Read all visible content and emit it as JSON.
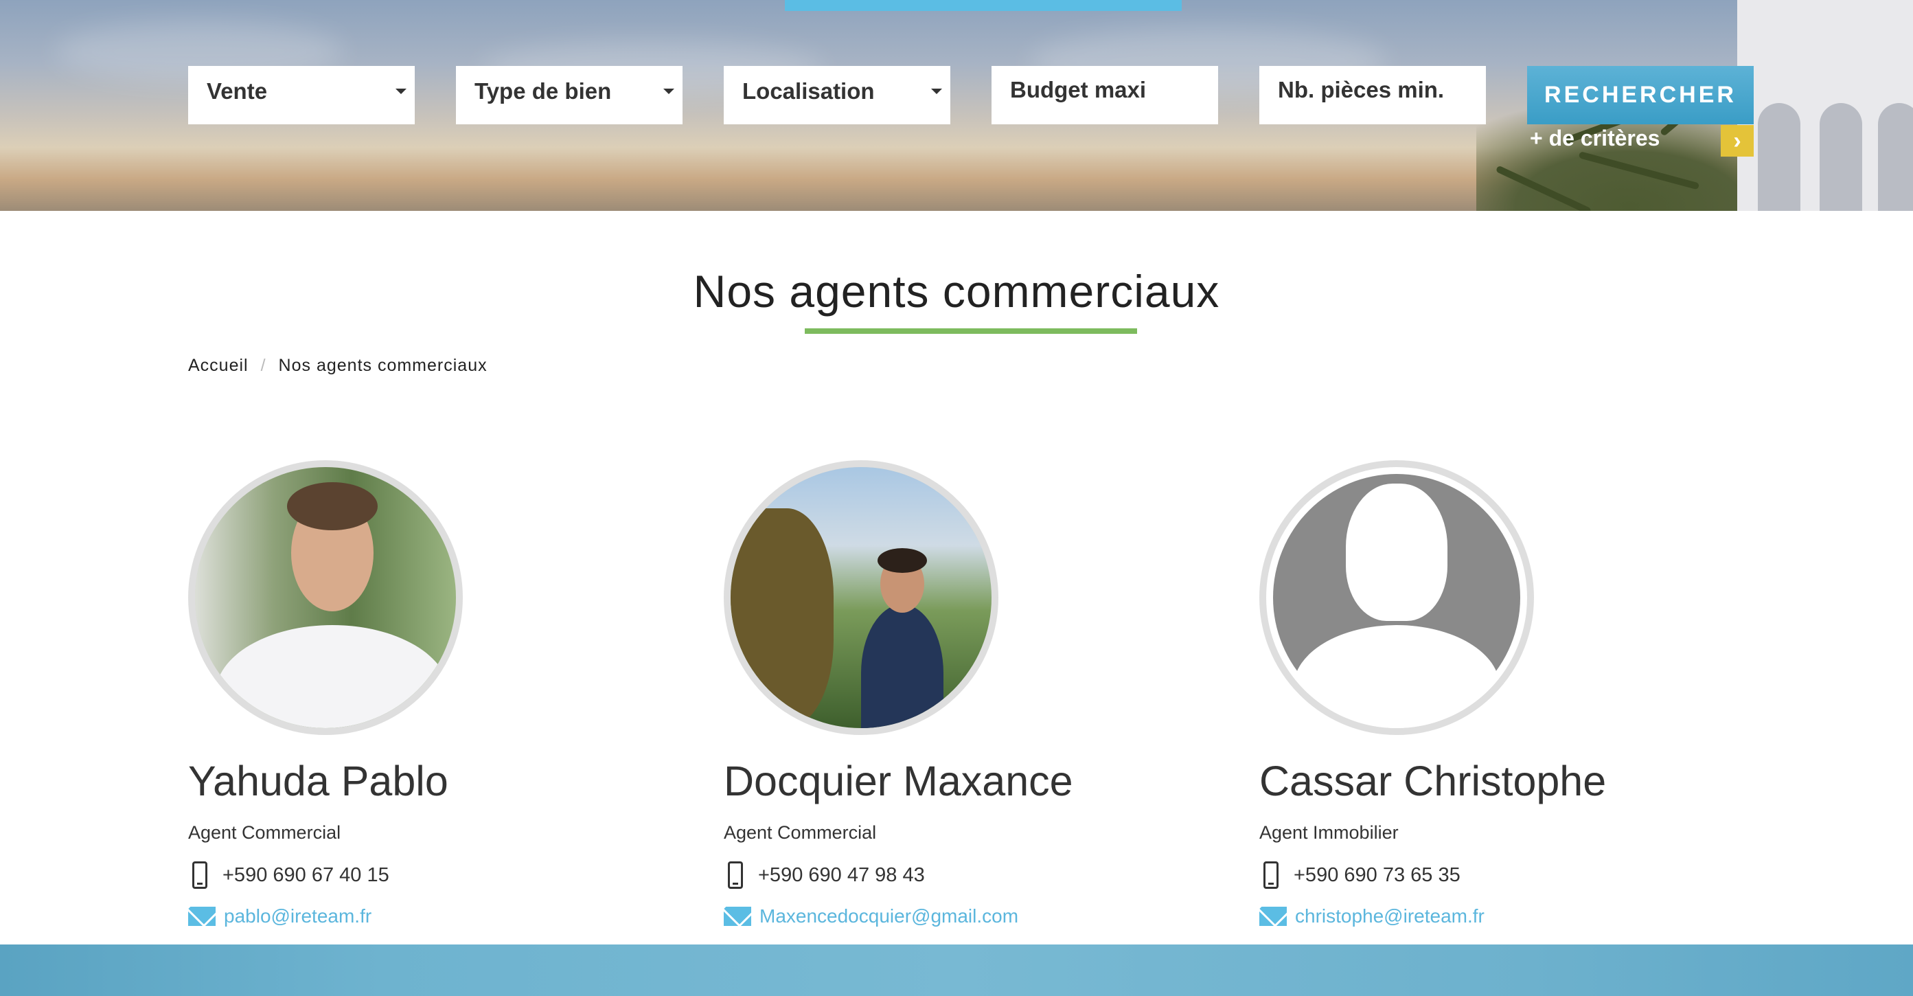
{
  "search": {
    "transaction_value": "Vente",
    "property_type_placeholder": "Type de bien",
    "location_placeholder": "Localisation",
    "budget_placeholder": "Budget maxi",
    "rooms_placeholder": "Nb. pièces min.",
    "submit_label": "RECHERCHER",
    "more_criteria_label": "+ de critères",
    "more_arrow": "›"
  },
  "page": {
    "title": "Nos agents commerciaux"
  },
  "breadcrumb": {
    "home": "Accueil",
    "separator": "/",
    "current": "Nos agents commerciaux"
  },
  "agents": [
    {
      "name": "Yahuda Pablo",
      "role": "Agent Commercial",
      "phone": "+590 690 67 40 15",
      "email": "pablo@ireteam.fr"
    },
    {
      "name": "Docquier Maxance",
      "role": "Agent Commercial",
      "phone": "+590 690 47 98 43",
      "email": "Maxencedocquier@gmail.com"
    },
    {
      "name": "Cassar Christophe",
      "role": "Agent Immobilier",
      "phone": "+590 690 73 65 35",
      "email": "christophe@ireteam.fr"
    }
  ],
  "icons": {
    "phone": "phone-icon",
    "email": "mail-icon",
    "dropdown": "caret-down-icon",
    "avatar_placeholder": "default-avatar-icon"
  },
  "colors": {
    "accent_blue": "#5bbde4",
    "button_blue": "#3a9dc6",
    "underline_green": "#7dbb5e",
    "more_criteria_yellow": "#e4c339",
    "link_blue": "#5bb6dd"
  }
}
